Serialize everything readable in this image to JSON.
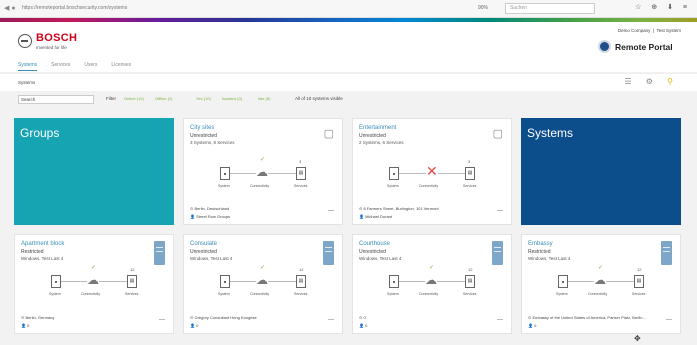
{
  "browser": {
    "url": "https://remoteportal.boschsecurity.com/systems",
    "zoom": "90%",
    "search_placeholder": "Suchen",
    "nav_icons": "◀ ●",
    "tool_icons": "☆ ⊕ ⬇ ≡"
  },
  "header": {
    "brand": "BOSCH",
    "tagline": "Invented for life",
    "company": "Demo Company",
    "user": "Test System",
    "portal_title": "Remote Portal",
    "tabs": [
      {
        "label": "Systems",
        "active": true
      },
      {
        "label": "Services",
        "active": false
      },
      {
        "label": "Users",
        "active": false
      },
      {
        "label": "Licenses",
        "active": false
      }
    ]
  },
  "subbar": {
    "breadcrumb": "Systems",
    "icons": [
      "list-view-icon",
      "gear-icon",
      "search-icon"
    ]
  },
  "filters": {
    "search_value": "Search",
    "filter_label": "Filter",
    "online": "Online (10)",
    "offline": "Offline (1)",
    "state_a": "Yes (10)",
    "state_b": "Isolated (0)",
    "state_c": "Idle (8)",
    "count": "All of 10 systems visible"
  },
  "labels": {
    "system": "System",
    "connectivity": "Connectivity",
    "services": "Services",
    "folder_icon": "▢",
    "more_icon": "—",
    "check_icon": "✓",
    "cross_icon": "✕",
    "cloud_icon": "☁",
    "pin_icon": "⊙",
    "person_icon": "👤",
    "svc_icon": "▤"
  },
  "cards": [
    {
      "kind": "big",
      "title": "Groups",
      "color": "#16a3b2"
    },
    {
      "kind": "group",
      "title": "City sites",
      "status": "Unrestricted",
      "sub": "3 Systems, 8 Services",
      "connected": true,
      "services_count": "3",
      "address": "Berlin, Deutschland",
      "contact": "Street Row Groups"
    },
    {
      "kind": "group",
      "title": "Entertainment",
      "status": "Unrestricted",
      "sub": "2 Systems, 6 Services",
      "connected": false,
      "services_count": "3",
      "address": "6 Farmers Street, Burlington, 101 Vermont",
      "contact": "Michael Durant"
    },
    {
      "kind": "big",
      "title": "Systems",
      "color": "#0c4d8c"
    },
    {
      "kind": "system",
      "title": "Apartment block",
      "status": "Restricted",
      "sub": "Windows, Test Last 4",
      "connected": true,
      "services_count": "12",
      "address": "Berlin, Germany",
      "contact": "0"
    },
    {
      "kind": "system",
      "title": "Consulate",
      "status": "Unrestricted",
      "sub": "Windows, Test Last 4",
      "connected": true,
      "services_count": "12",
      "address": "Gregory Consultant Hong Kongese",
      "contact": "0"
    },
    {
      "kind": "system",
      "title": "Courthouse",
      "status": "Unrestricted",
      "sub": "Windows, Test Last 4",
      "connected": true,
      "services_count": "12",
      "address": "0",
      "contact": "0"
    },
    {
      "kind": "system",
      "title": "Embassy",
      "status": "Restricted",
      "sub": "Windows, Test Last 4",
      "connected": true,
      "services_count": "12",
      "address": "Embassy of the United States of America, Pariser Platz, Berlin...",
      "contact": "0"
    }
  ],
  "cursor_icon": "✥"
}
